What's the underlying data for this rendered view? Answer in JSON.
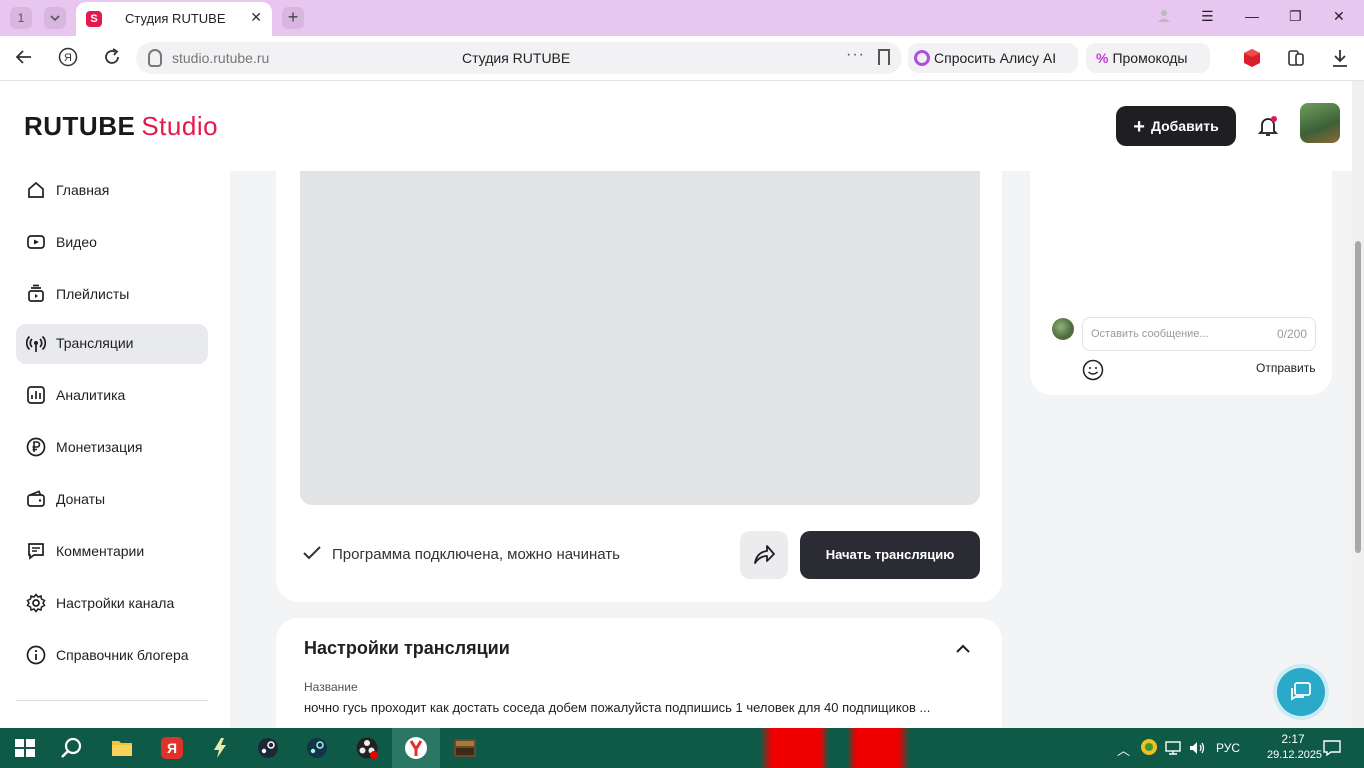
{
  "browser": {
    "tab_number": "1",
    "tab_title": "Студия RUTUBE",
    "url": "studio.rutube.ru",
    "page_title": "Студия RUTUBE",
    "alice_label": "Спросить Алису AI",
    "promo_label": "Промокоды"
  },
  "header": {
    "logo_main": "RUTUBE",
    "logo_studio": "Studio",
    "add_button": "Добавить"
  },
  "sidebar": {
    "items": [
      {
        "label": "Главная",
        "icon": "home-icon"
      },
      {
        "label": "Видео",
        "icon": "video-icon"
      },
      {
        "label": "Плейлисты",
        "icon": "playlist-icon"
      },
      {
        "label": "Трансляции",
        "icon": "broadcast-icon",
        "active": true
      },
      {
        "label": "Аналитика",
        "icon": "analytics-icon"
      },
      {
        "label": "Монетизация",
        "icon": "ruble-icon"
      },
      {
        "label": "Донаты",
        "icon": "wallet-icon"
      },
      {
        "label": "Комментарии",
        "icon": "comment-icon"
      },
      {
        "label": "Настройки канала",
        "icon": "gear-icon"
      },
      {
        "label": "Справочник блогера",
        "icon": "info-icon"
      }
    ]
  },
  "stream": {
    "status": "Программа подключена, можно начинать",
    "start_button": "Начать трансляцию"
  },
  "settings": {
    "title": "Настройки трансляции",
    "name_label": "Название",
    "name_value": "ночно гусь проходит как достать соседа добем пожалуйста подпишись 1 человек для 40 подпищиков ..."
  },
  "chat": {
    "placeholder": "Оставить сообщение...",
    "counter": "0/200",
    "send_label": "Отправить"
  },
  "taskbar": {
    "lang": "РУС",
    "time": "2:17",
    "date": "29.12.2025"
  },
  "colors": {
    "accent": "#e5194b",
    "dark_button": "#1f1f23",
    "active_nav": "#e9eaee",
    "tab_strip": "#e7c6ef",
    "taskbar": "#0f5a47"
  }
}
